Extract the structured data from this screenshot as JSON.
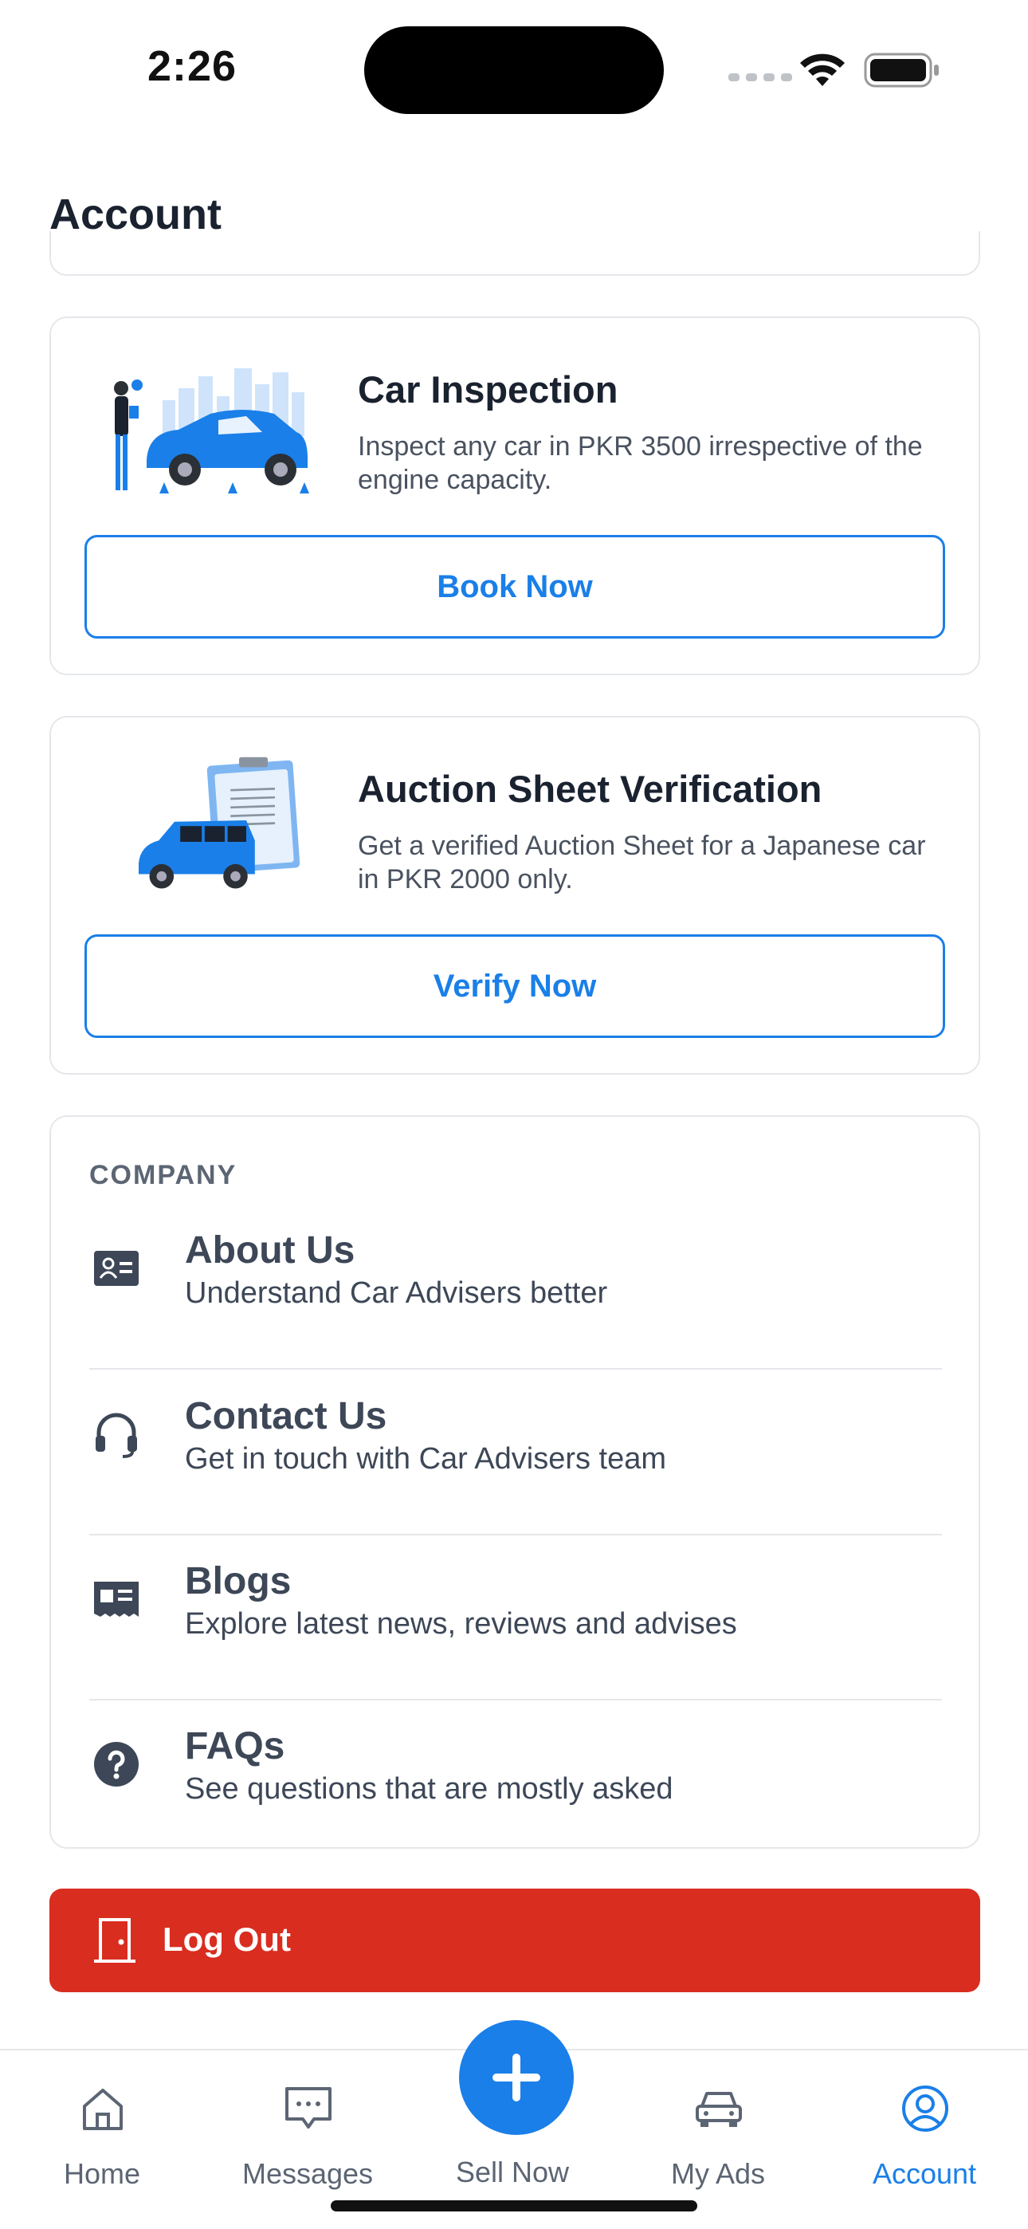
{
  "status_bar": {
    "time": "2:26"
  },
  "header": {
    "title": "Account"
  },
  "promo_cards": [
    {
      "title": "Car Inspection",
      "description": "Inspect any car in PKR 3500 irrespective of the engine capacity.",
      "button_label": "Book Now"
    },
    {
      "title": "Auction Sheet Verification",
      "description": "Get a verified Auction Sheet for a Japanese car in PKR 2000 only.",
      "button_label": "Verify Now"
    }
  ],
  "company": {
    "section_label": "COMPANY",
    "items": [
      {
        "title": "About Us",
        "subtitle": "Understand Car Advisers better",
        "icon": "id-card-icon"
      },
      {
        "title": "Contact Us",
        "subtitle": "Get in touch with Car Advisers team",
        "icon": "headset-icon"
      },
      {
        "title": "Blogs",
        "subtitle": "Explore latest news, reviews and advises",
        "icon": "newspaper-icon"
      },
      {
        "title": "FAQs",
        "subtitle": "See questions that are mostly asked",
        "icon": "question-circle-icon"
      }
    ]
  },
  "logout": {
    "label": "Log Out",
    "color": "#d92d20"
  },
  "tab_bar": {
    "tabs": [
      {
        "label": "Home",
        "icon": "home-icon"
      },
      {
        "label": "Messages",
        "icon": "message-icon"
      },
      {
        "label": "Sell Now",
        "icon": "plus-icon"
      },
      {
        "label": "My Ads",
        "icon": "car-icon"
      },
      {
        "label": "Account",
        "icon": "account-icon",
        "active": true
      }
    ],
    "accent_color": "#1a7fe8"
  }
}
